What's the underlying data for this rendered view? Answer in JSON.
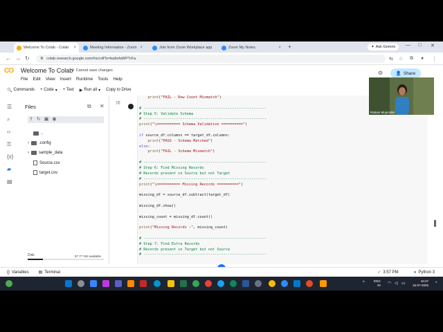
{
  "browser": {
    "tabs": [
      {
        "title": "Welcome To Colab - Colab",
        "color": "#f9ab00",
        "active": true
      },
      {
        "title": "Meeting Information - Zoom",
        "color": "#2d8cff",
        "active": false
      },
      {
        "title": "Join from Zoom Workplace app",
        "color": "#2d8cff",
        "active": false
      },
      {
        "title": "Zoom My Notes",
        "color": "#2d8cff",
        "active": false
      }
    ],
    "new_tab": "+",
    "ask_gemini": "Ask Gemini",
    "url": "colab.research.google.com/#scrollTo=ka6efaWPTrFa"
  },
  "colab": {
    "logo": "CO",
    "title": "Welcome To Colab",
    "save_msg": "Cannot save changes",
    "menu": [
      "File",
      "Edit",
      "View",
      "Insert",
      "Runtime",
      "Tools",
      "Help"
    ],
    "share": "Share",
    "toolbar": {
      "commands": "Commands",
      "code": "+ Code",
      "text": "+ Text",
      "run_all": "Run all",
      "copy_drive": "Copy to Drive"
    }
  },
  "files": {
    "header": "Files",
    "items": [
      {
        "name": "..",
        "type": "folder"
      },
      {
        "name": ".config",
        "type": "folder"
      },
      {
        "name": "sample_data",
        "type": "folder"
      },
      {
        "name": "Source.csv",
        "type": "file"
      },
      {
        "name": "target.csv",
        "type": "file"
      }
    ],
    "disk_label": "Disk",
    "disk_free": "87.77 GB available",
    "disk_used_fraction": 0.2
  },
  "cell": {
    "exec_count": "[3]"
  },
  "video": {
    "name": "Rabani Mujumder"
  },
  "statusbar": {
    "variables": "Variables",
    "terminal": "Terminal",
    "time": "3:57 PM",
    "runtime": "Python 3"
  },
  "taskbar": {
    "lang": "ENG",
    "region": "IN",
    "clock": "16:27",
    "date": "15-07-2025"
  }
}
